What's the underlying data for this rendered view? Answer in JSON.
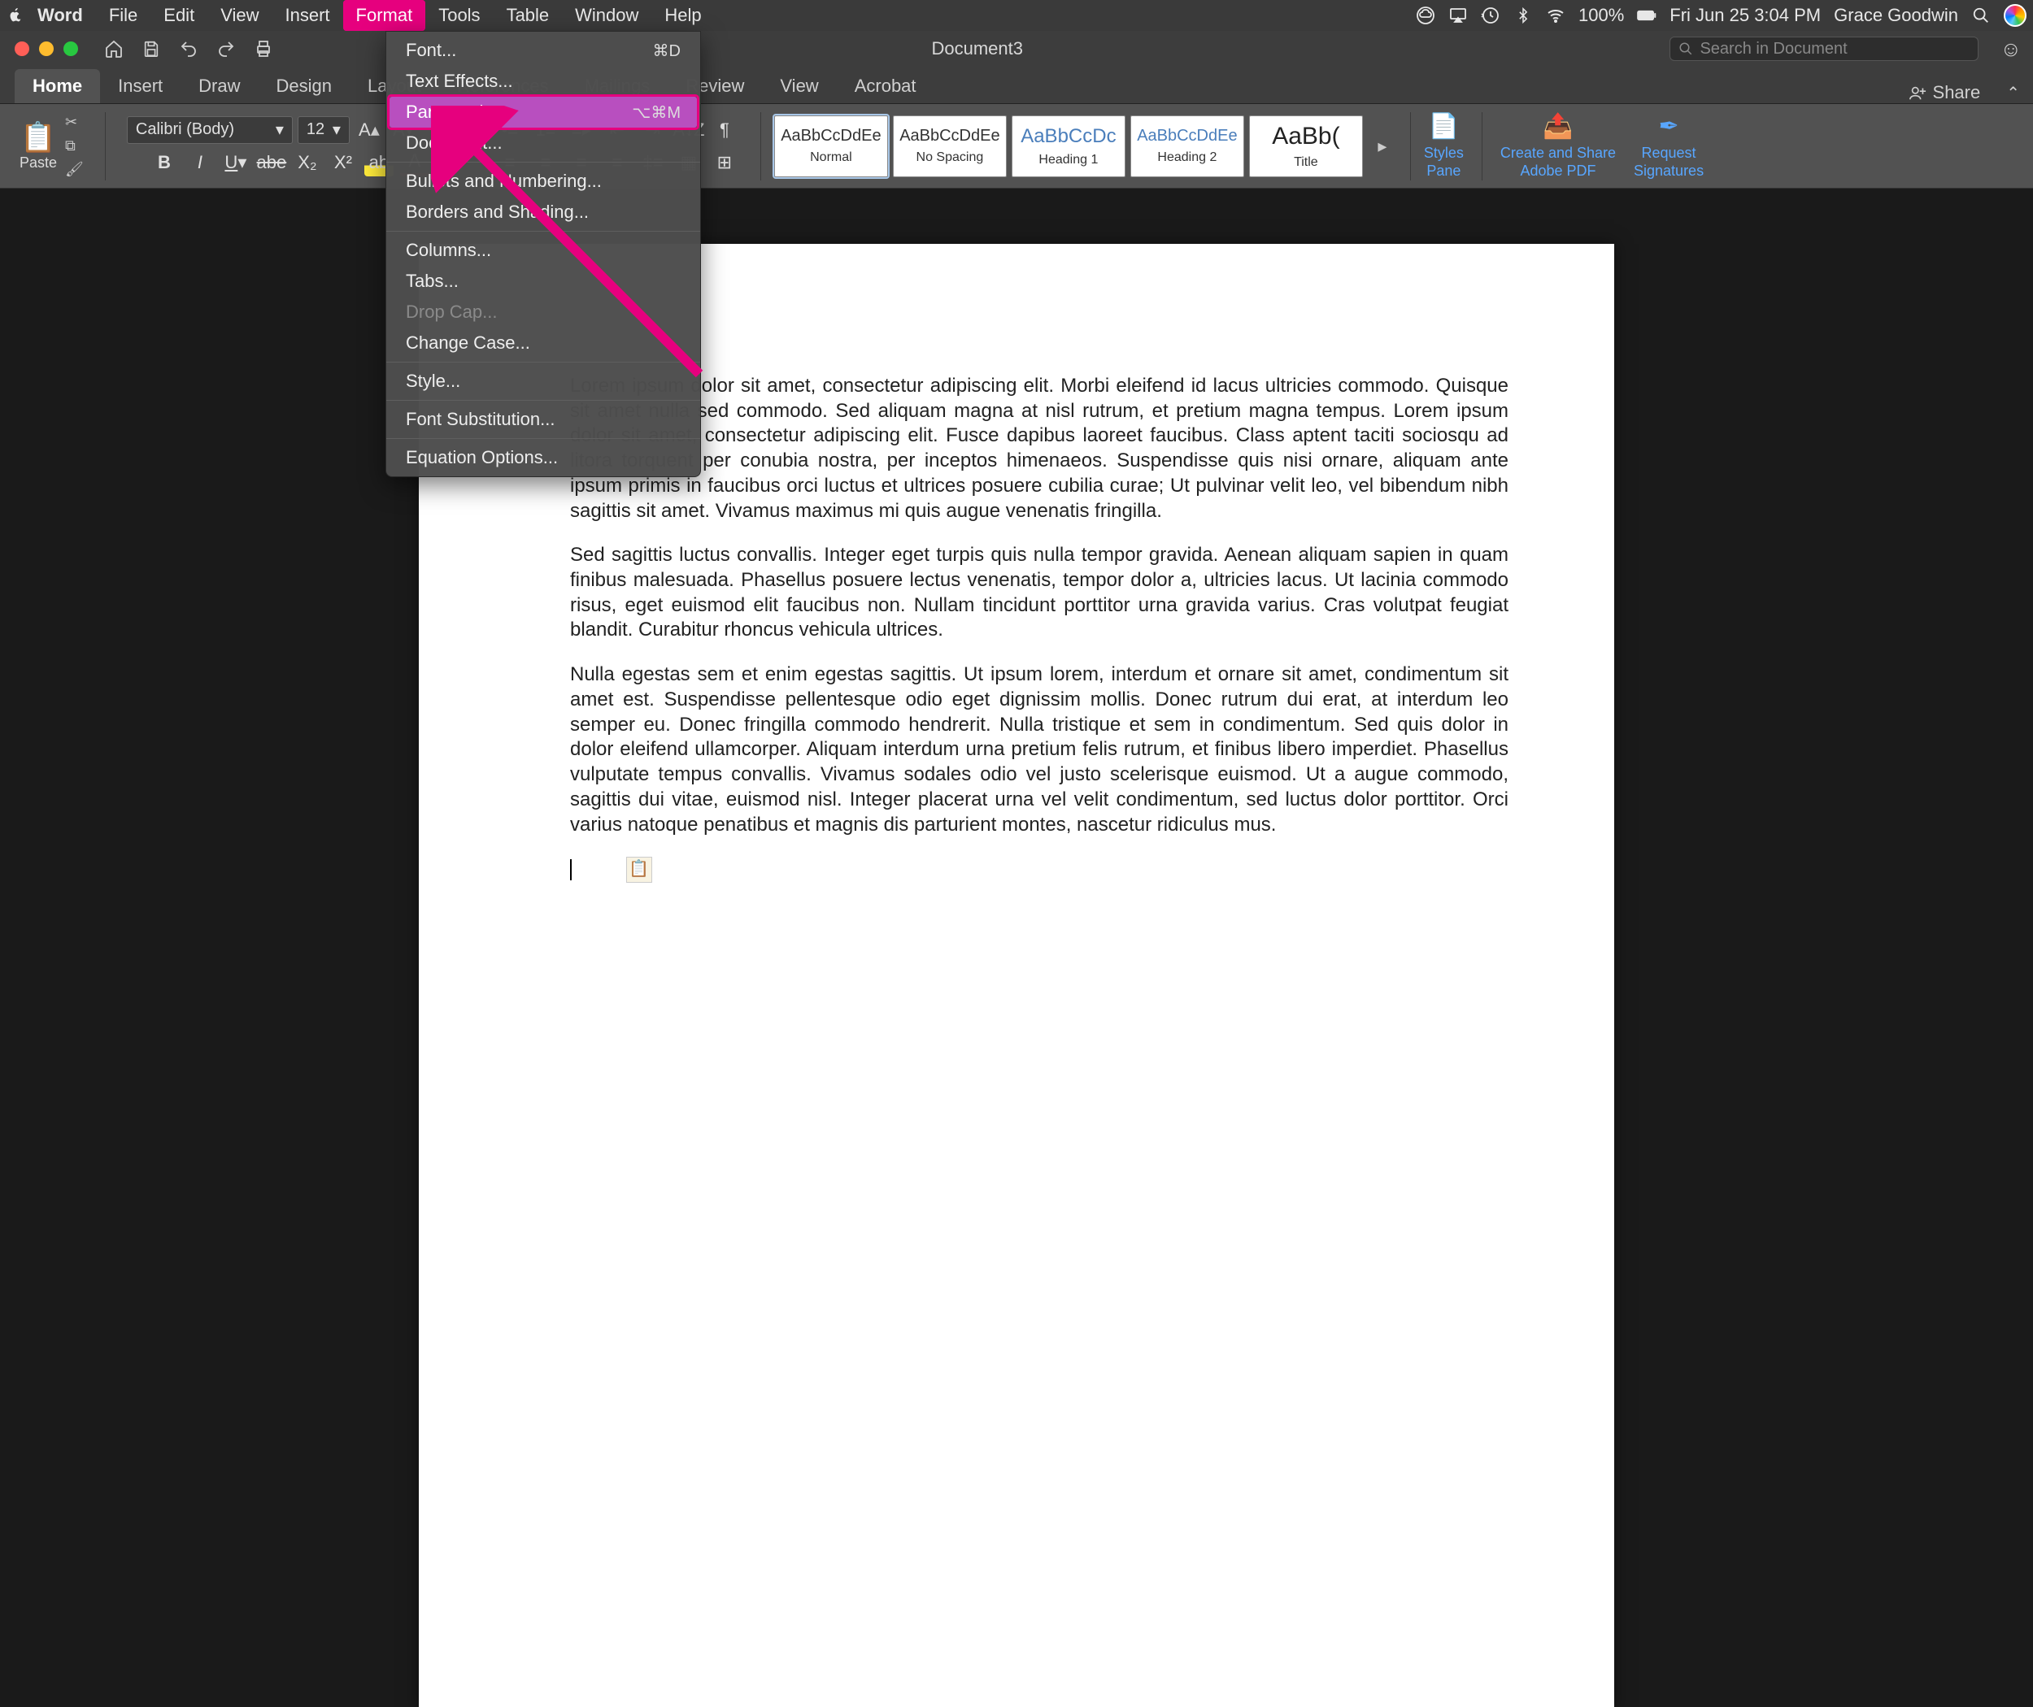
{
  "menubar": {
    "app": "Word",
    "items": [
      "File",
      "Edit",
      "View",
      "Insert",
      "Format",
      "Tools",
      "Table",
      "Window",
      "Help"
    ],
    "active": "Format",
    "status": {
      "battery": "100%",
      "datetime": "Fri Jun 25  3:04 PM",
      "user": "Grace Goodwin"
    }
  },
  "titlebar": {
    "title": "Document3",
    "search_placeholder": "Search in Document"
  },
  "ribbon_tabs": {
    "tabs": [
      "Home",
      "Insert",
      "Draw",
      "Design",
      "Layout",
      "References",
      "Mailings",
      "Review",
      "View",
      "Acrobat"
    ],
    "active": "Home",
    "share": "Share"
  },
  "ribbon": {
    "paste": "Paste",
    "font_name": "Calibri (Body)",
    "font_size": "12",
    "styles": [
      {
        "preview": "AaBbCcDdEe",
        "label": "Normal"
      },
      {
        "preview": "AaBbCcDdEe",
        "label": "No Spacing"
      },
      {
        "preview": "AaBbCcDc",
        "label": "Heading 1"
      },
      {
        "preview": "AaBbCcDdEe",
        "label": "Heading 2"
      },
      {
        "preview": "AaBb(",
        "label": "Title"
      }
    ],
    "right": {
      "styles_pane": "Styles\nPane",
      "create_share": "Create and Share\nAdobe PDF",
      "request_sig": "Request\nSignatures"
    }
  },
  "dropdown": {
    "items": [
      {
        "label": "Font...",
        "shortcut": "⌘D"
      },
      {
        "label": "Text Effects..."
      },
      {
        "label": "Paragraph...",
        "shortcut": "⌥⌘M",
        "highlighted": true
      },
      {
        "label": "Document..."
      },
      {
        "sep": true
      },
      {
        "label": "Bullets and Numbering..."
      },
      {
        "label": "Borders and Shading..."
      },
      {
        "sep": true
      },
      {
        "label": "Columns..."
      },
      {
        "label": "Tabs..."
      },
      {
        "label": "Drop Cap...",
        "disabled": true
      },
      {
        "label": "Change Case..."
      },
      {
        "sep": true
      },
      {
        "label": "Style..."
      },
      {
        "sep": true
      },
      {
        "label": "Font Substitution..."
      },
      {
        "sep": true
      },
      {
        "label": "Equation Options..."
      }
    ]
  },
  "document": {
    "p1": "Lorem ipsum dolor sit amet, consectetur adipiscing elit. Morbi eleifend id lacus ultricies commodo. Quisque sit amet nulla sed commodo. Sed aliquam magna at nisl rutrum, et pretium magna tempus. Lorem ipsum dolor sit amet, consectetur adipiscing elit. Fusce dapibus laoreet faucibus. Class aptent taciti sociosqu ad litora torquent per conubia nostra, per inceptos himenaeos. Suspendisse quis nisi ornare, aliquam ante ipsum primis in faucibus orci luctus et ultrices posuere cubilia curae; Ut pulvinar velit leo, vel bibendum nibh sagittis sit amet. Vivamus maximus mi quis augue venenatis fringilla.",
    "p2": "Sed sagittis luctus convallis. Integer eget turpis quis nulla tempor gravida. Aenean aliquam sapien in quam finibus malesuada. Phasellus posuere lectus venenatis, tempor dolor a, ultricies lacus. Ut lacinia commodo risus, eget euismod elit faucibus non. Nullam tincidunt porttitor urna gravida varius. Cras volutpat feugiat blandit. Curabitur rhoncus vehicula ultrices.",
    "p3": "Nulla egestas sem et enim egestas sagittis. Ut ipsum lorem, interdum et ornare sit amet, condimentum sit amet est. Suspendisse pellentesque odio eget dignissim mollis. Donec rutrum dui erat, at interdum leo semper eu. Donec fringilla commodo hendrerit. Nulla tristique et sem in condimentum. Sed quis dolor in dolor eleifend ullamcorper. Aliquam interdum urna pretium felis rutrum, et finibus libero imperdiet. Phasellus vulputate tempus convallis. Vivamus sodales odio vel justo scelerisque euismod. Ut a augue commodo, sagittis dui vitae, euismod nisl. Integer placerat urna vel velit condimentum, sed luctus dolor porttitor. Orci varius natoque penatibus et magnis dis parturient montes, nascetur ridiculus mus."
  }
}
